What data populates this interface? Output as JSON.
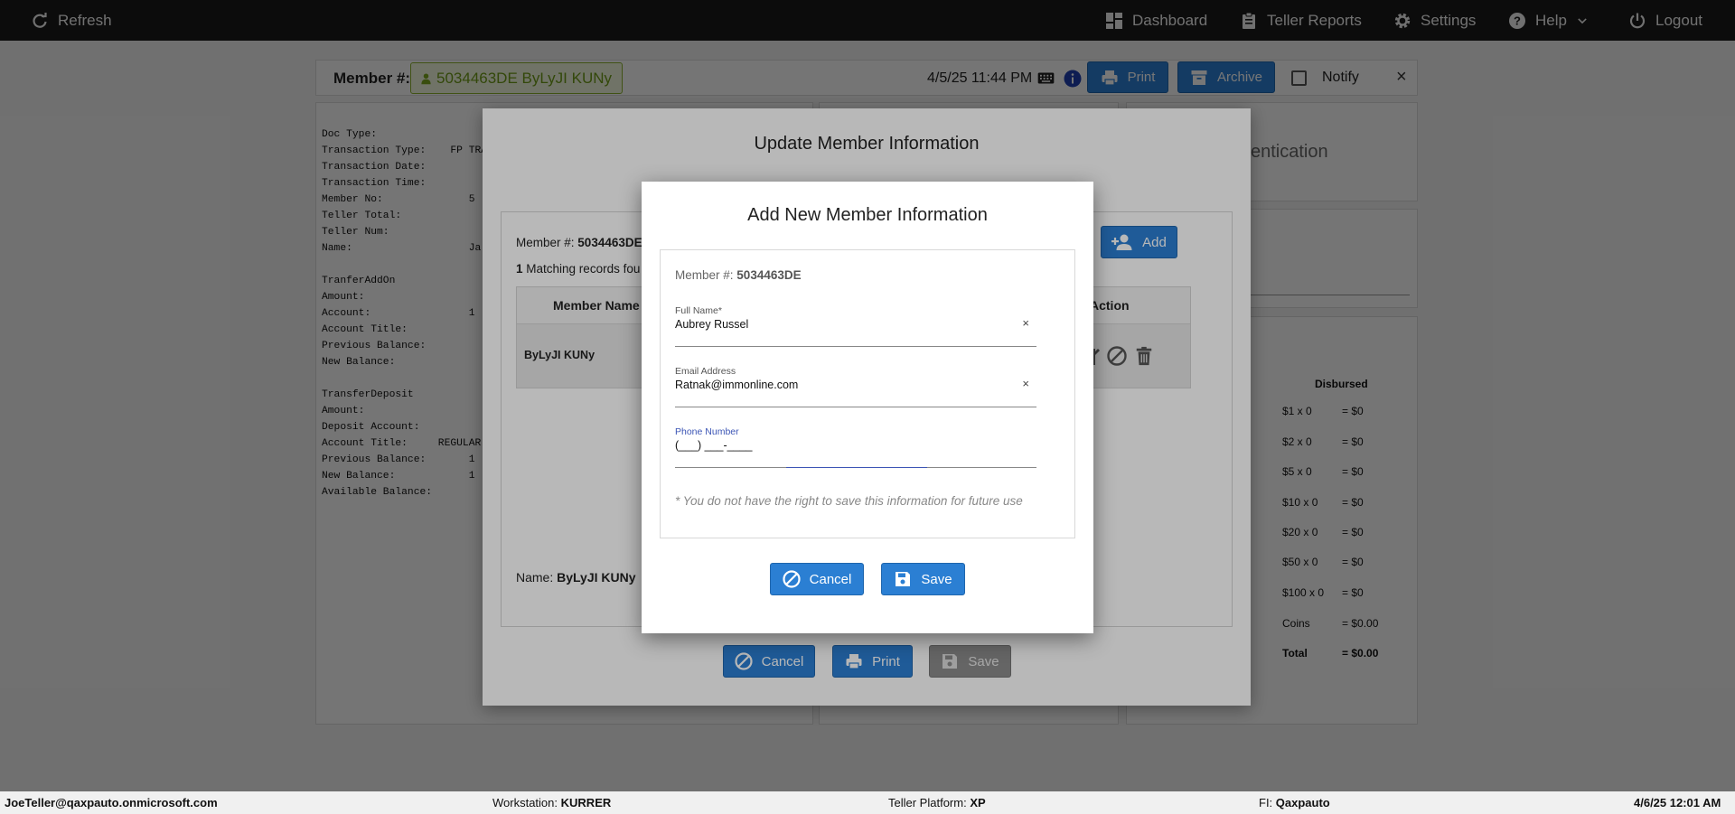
{
  "topbar": {
    "refresh": "Refresh",
    "dashboard": "Dashboard",
    "teller_reports": "Teller Reports",
    "settings": "Settings",
    "help": "Help",
    "logout": "Logout"
  },
  "member_bar": {
    "label": "Member #:",
    "member_value": "5034463DE ByLyJI KUNy",
    "datetime": "4/5/25 11:44 PM",
    "print": "Print",
    "archive": "Archive",
    "notify": "Notify"
  },
  "receipt": {
    "lines": "Doc Type:\nTransaction Type:    FP TRA\nTransaction Date:\nTransaction Time:\nMember No:              5\nTeller Total:\nTeller Num:\nName:                   Ja\n\nTranferAddOn\nAmount:\nAccount:                1\nAccount Title:\nPrevious Balance:\nNew Balance:\n\nTransferDeposit\nAmount:\nDeposit Account:\nAccount Title:     REGULAR\nPrevious Balance:       1\nNew Balance:            1\nAvailable Balance:"
  },
  "right_panel": {
    "auth_partial": "entication",
    "disbursed_header": "Disbursed",
    "rows": [
      {
        "denom": "$1 x 0",
        "amount": "= $0"
      },
      {
        "denom": "$2 x 0",
        "amount": "= $0"
      },
      {
        "denom": "$5 x 0",
        "amount": "= $0"
      },
      {
        "denom": "$10 x 0",
        "amount": "= $0"
      },
      {
        "denom": "$20 x 0",
        "amount": "= $0"
      },
      {
        "denom": "$50 x 0",
        "amount": "= $0"
      },
      {
        "denom": "$100 x 0",
        "amount": "= $0"
      },
      {
        "denom": "Coins",
        "amount": "= $0.00"
      }
    ],
    "total_label": "Total",
    "total_value": "= $0.00"
  },
  "update_modal": {
    "title": "Update Member Information",
    "member_label": "Member #:",
    "member_value": "5034463DE",
    "add_button": "Add",
    "matching_count": "1",
    "matching_text": "Matching records fou",
    "col_member_name": "Member Name",
    "col_action": "Action",
    "row_name": "ByLyJI KUNy",
    "name_label": "Name:",
    "name_value": "ByLyJI KUNy",
    "cancel": "Cancel",
    "print": "Print",
    "save": "Save"
  },
  "add_modal": {
    "title": "Add New Member Information",
    "member_label": "Member #:",
    "member_value": "5034463DE",
    "full_name_label": "Full Name*",
    "full_name_value": "Aubrey Russel",
    "email_label": "Email Address",
    "email_value": "Ratnak@immonline.com",
    "phone_label": "Phone Number",
    "phone_value": "(___) ___-____",
    "clear_glyph": "×",
    "disclaimer": "* You do not have the right to save this information for future use",
    "cancel": "Cancel",
    "save": "Save"
  },
  "footer": {
    "user": "JoeTeller@qaxpauto.onmicrosoft.com",
    "workstation_label": "Workstation:",
    "workstation_value": "KURRER",
    "platform_label": "Teller Platform:",
    "platform_value": "XP",
    "fi_label": "FI:",
    "fi_value": "Qaxpauto",
    "datetime": "4/6/25 12:01 AM"
  },
  "colors": {
    "primary_blue": "#2b7fd3",
    "topbar_bg": "#1b1b1b",
    "member_badge_green": "#6e9a17",
    "focus_indigo": "#3c55b5"
  }
}
